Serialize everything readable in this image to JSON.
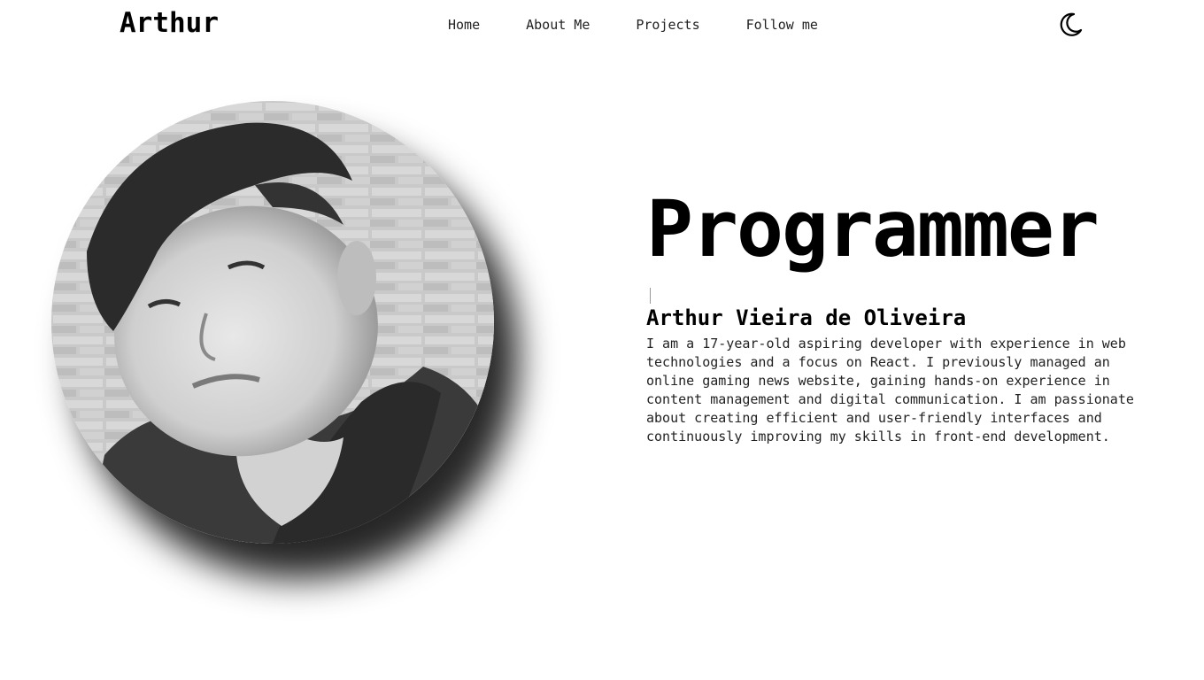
{
  "header": {
    "logo": "Arthur",
    "nav": [
      {
        "label": "Home"
      },
      {
        "label": "About Me"
      },
      {
        "label": "Projects"
      },
      {
        "label": "Follow me"
      }
    ],
    "theme_toggle_icon": "moon-icon"
  },
  "hero": {
    "photo_icon": "profile-photo",
    "headline": "Programmer",
    "name": "Arthur Vieira de Oliveira",
    "bio": "I am a 17-year-old aspiring developer with experience in web technologies and a focus on React. I previously managed an online gaming news website, gaining hands-on experience in content management and digital communication. I am passionate about creating efficient and user-friendly interfaces and continuously improving my skills in front-end development."
  },
  "colors": {
    "background": "#ffffff",
    "text": "#000000"
  }
}
